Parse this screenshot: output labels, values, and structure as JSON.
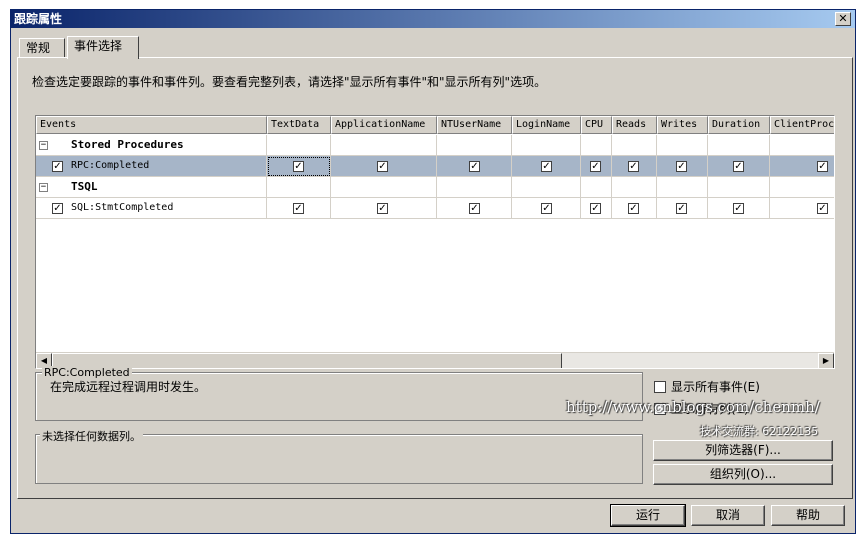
{
  "window": {
    "title": "跟踪属性",
    "close_glyph": "✕"
  },
  "tabs": [
    {
      "label": "常规",
      "active": false
    },
    {
      "label": "事件选择",
      "active": true
    }
  ],
  "instructions": "检查选定要跟踪的事件和事件列。要查看完整列表，请选择\"显示所有事件\"和\"显示所有列\"选项。",
  "grid": {
    "columns": [
      "Events",
      "TextData",
      "ApplicationName",
      "NTUserName",
      "LoginName",
      "CPU",
      "Reads",
      "Writes",
      "Duration",
      "ClientProc"
    ],
    "groups": [
      {
        "expander": "−",
        "name": "Stored Procedures"
      },
      {
        "expander": "−",
        "name": "TSQL"
      }
    ],
    "rows": [
      {
        "event": "RPC:Completed",
        "selected": true
      },
      {
        "event": "SQL:StmtCompleted",
        "selected": false
      }
    ],
    "check_glyph": "✓",
    "scroll_left_glyph": "◀",
    "scroll_right_glyph": "▶"
  },
  "description_box": {
    "title": "RPC:Completed",
    "text": "在完成远程过程调用时发生。"
  },
  "column_box": {
    "title": "未选择任何数据列。"
  },
  "options": {
    "show_all_events": "显示所有事件(E)",
    "show_all_columns": "显示所有列(C)"
  },
  "buttons": {
    "column_filters": "列筛选器(F)...",
    "organize_columns": "组织列(O)...",
    "run": "运行",
    "cancel": "取消",
    "help": "帮助"
  },
  "watermark": {
    "url": "http://www.cnblogs.com/chenmh/",
    "group": "技术交流群: 62122135"
  }
}
